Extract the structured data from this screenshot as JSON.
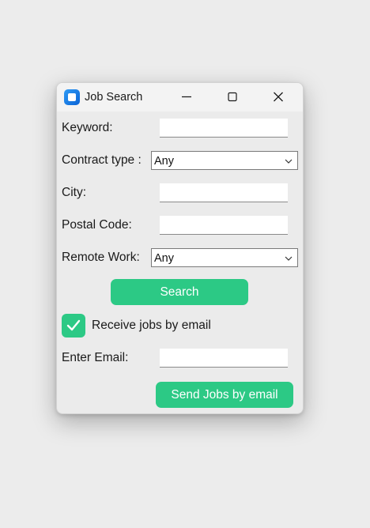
{
  "window": {
    "title": "Job Search",
    "icon": "app-icon",
    "controls": [
      "minimize-icon",
      "maximize-icon",
      "close-icon"
    ]
  },
  "form": {
    "keyword": {
      "label": "Keyword:",
      "value": ""
    },
    "contract_type": {
      "label": "Contract type :",
      "selected": "Any"
    },
    "city": {
      "label": "City:",
      "value": ""
    },
    "postal_code": {
      "label": "Postal Code:",
      "value": ""
    },
    "remote_work": {
      "label": "Remote Work:",
      "selected": "Any"
    },
    "search_button": "Search",
    "receive_jobs": {
      "label": "Receive jobs by email",
      "checked": true
    },
    "email": {
      "label": "Enter Email:",
      "value": ""
    },
    "send_button": "Send Jobs by email"
  },
  "colors": {
    "accent": "#2cc985",
    "window_bg": "#ebebeb",
    "titlebar_bg": "#f3f3f3",
    "desktop_bg": "#ececec"
  }
}
